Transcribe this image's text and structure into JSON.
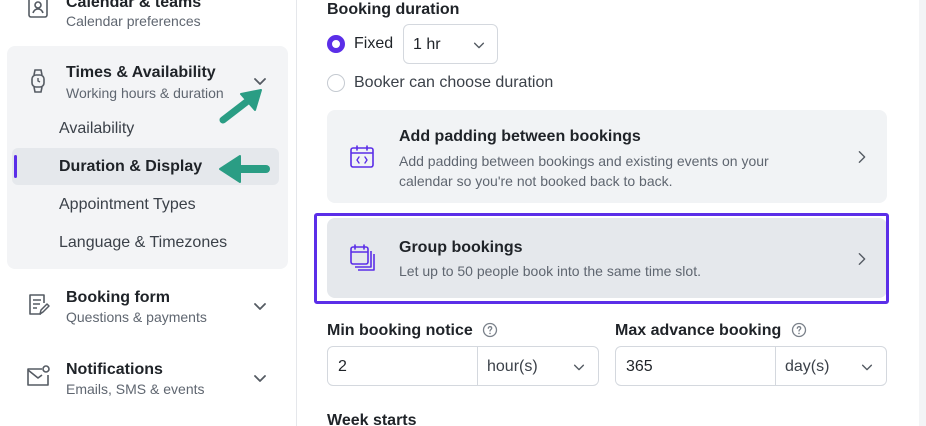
{
  "sidebar": {
    "calendar_teams": {
      "title": "Calendar & teams",
      "subtitle": "Calendar preferences"
    },
    "times_availability": {
      "title": "Times & Availability",
      "subtitle": "Working hours & duration",
      "children": [
        "Availability",
        "Duration & Display",
        "Appointment Types",
        "Language & Timezones"
      ],
      "active_child": "Duration & Display"
    },
    "booking_form": {
      "title": "Booking form",
      "subtitle": "Questions & payments"
    },
    "notifications": {
      "title": "Notifications",
      "subtitle": "Emails, SMS & events"
    }
  },
  "main": {
    "booking_duration": {
      "label": "Booking duration",
      "fixed_label": "Fixed",
      "fixed_value": "1 hr",
      "booker_choose_label": "Booker can choose duration"
    },
    "padding_card": {
      "title": "Add padding between bookings",
      "description": "Add padding between bookings and existing events on your calendar so you're not booked back to back."
    },
    "group_card": {
      "title": "Group bookings",
      "description": "Let up to 50 people book into the same time slot."
    },
    "min_notice": {
      "label": "Min booking notice",
      "value": "2",
      "unit": "hour(s)"
    },
    "max_advance": {
      "label": "Max advance booking",
      "value": "365",
      "unit": "day(s)"
    },
    "week_starts": {
      "label": "Week starts"
    }
  },
  "colors": {
    "accent": "#5b2ee8",
    "annotation_arrow": "#2a9d84"
  }
}
